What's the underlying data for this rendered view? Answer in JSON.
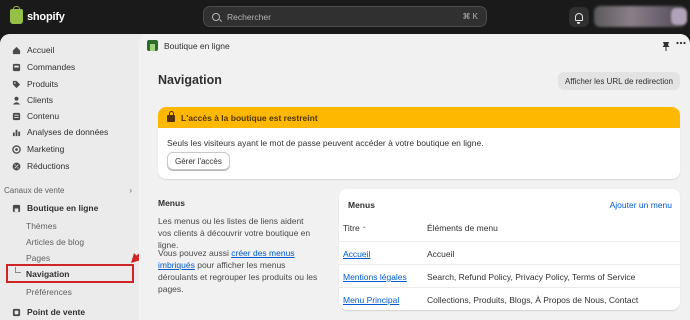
{
  "topbar": {
    "brand": "shopify",
    "search_placeholder": "Rechercher",
    "search_shortcut": "⌘ K"
  },
  "sidebar": {
    "items": [
      {
        "label": "Accueil",
        "icon": "home-icon"
      },
      {
        "label": "Commandes",
        "icon": "inbox-icon"
      },
      {
        "label": "Produits",
        "icon": "tag-icon"
      },
      {
        "label": "Clients",
        "icon": "person-icon"
      },
      {
        "label": "Contenu",
        "icon": "content-icon"
      },
      {
        "label": "Analyses de données",
        "icon": "chart-icon"
      },
      {
        "label": "Marketing",
        "icon": "target-icon"
      },
      {
        "label": "Réductions",
        "icon": "discount-icon"
      }
    ],
    "sales_channels_label": "Canaux de vente",
    "online_store_label": "Boutique en ligne",
    "sub_items": [
      "Thèmes",
      "Articles de blog",
      "Pages",
      "Navigation",
      "Préférences"
    ],
    "pos_label": "Point de vente"
  },
  "header": {
    "breadcrumb": "Boutique en ligne"
  },
  "main": {
    "title": "Navigation",
    "redirect_button": "Afficher les URL de redirection",
    "banner": {
      "title": "L'accès à la boutique est restreint",
      "text": "Seuls les visiteurs ayant le mot de passe peuvent accéder à votre boutique en ligne.",
      "button": "Gérer l'accès"
    },
    "menus_section": {
      "title": "Menus",
      "desc": "Les menus ou les listes de liens aident vos clients à découvrir votre boutique en ligne.",
      "desc2_pre": "Vous pouvez aussi ",
      "desc2_link": "créer des menus imbriqués",
      "desc2_post": " pour afficher les menus déroulants et regrouper les produits ou les pages."
    },
    "menus_card": {
      "title": "Menus",
      "add_link": "Ajouter un menu",
      "col_title": "Titre",
      "col_items": "Éléments de menu",
      "rows": [
        {
          "title": "Accueil",
          "items": "Accueil"
        },
        {
          "title": "Mentions légales",
          "items": "Search, Refund Policy, Privacy Policy, Terms of Service"
        },
        {
          "title": "Menu Principal",
          "items": "Collections, Produits, Blogs, À Propos de Nous, Contact"
        }
      ]
    }
  },
  "colors": {
    "banner_bg": "#ffb800",
    "link": "#005bd3",
    "highlight": "#d12525"
  }
}
